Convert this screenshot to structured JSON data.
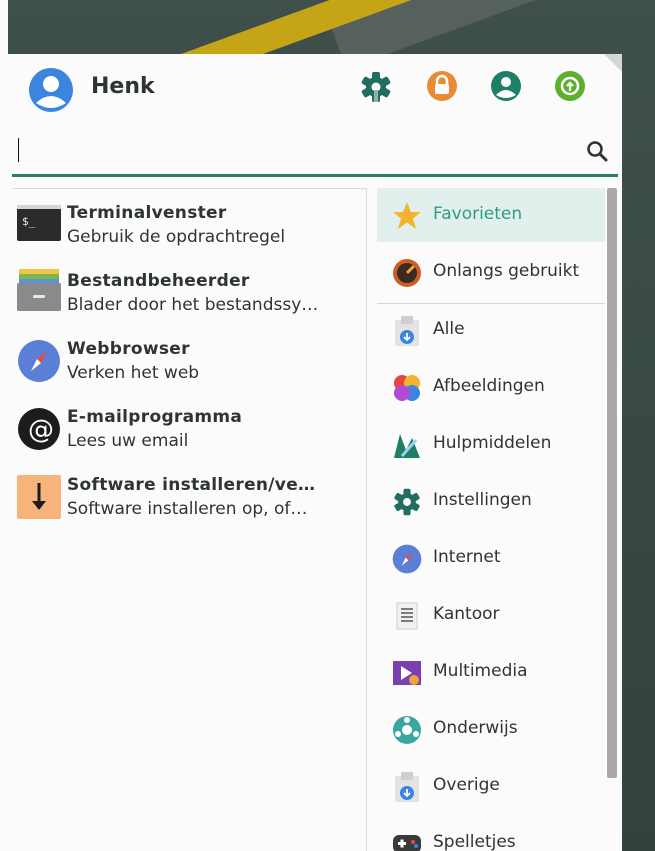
{
  "user": {
    "name": "Henk"
  },
  "header": {
    "buttons": [
      {
        "name": "settings-button",
        "icon": "gear-icon",
        "color": "#1f6e5e"
      },
      {
        "name": "lock-button",
        "icon": "lock-icon",
        "color": "#e98b36"
      },
      {
        "name": "user-button",
        "icon": "user-icon",
        "color": "#1f7e66"
      },
      {
        "name": "power-button",
        "icon": "power-icon",
        "color": "#5cb02c"
      }
    ]
  },
  "search": {
    "value": ""
  },
  "apps": [
    {
      "title": "Terminalvenster",
      "subtitle": "Gebruik de opdrachtregel",
      "icon": "terminal-icon"
    },
    {
      "title": "Bestandbeheerder",
      "subtitle": "Blader door het bestandssy…",
      "icon": "file-manager-icon"
    },
    {
      "title": "Webbrowser",
      "subtitle": "Verken het web",
      "icon": "web-browser-icon"
    },
    {
      "title": "E-mailprogramma",
      "subtitle": "Lees uw email",
      "icon": "email-icon"
    },
    {
      "title": "Software installeren/ve…",
      "subtitle": "Software installeren op, of…",
      "icon": "software-install-icon"
    }
  ],
  "categories": [
    {
      "label": "Favorieten",
      "icon": "star-icon",
      "selected": true
    },
    {
      "label": "Onlangs gebruikt",
      "icon": "recent-icon"
    },
    {
      "label": "Alle",
      "icon": "package-icon"
    },
    {
      "label": "Afbeeldingen",
      "icon": "image-icon"
    },
    {
      "label": "Hulpmiddelen",
      "icon": "tools-icon"
    },
    {
      "label": "Instellingen",
      "icon": "settings-icon"
    },
    {
      "label": "Internet",
      "icon": "internet-icon"
    },
    {
      "label": "Kantoor",
      "icon": "office-icon"
    },
    {
      "label": "Multimedia",
      "icon": "multimedia-icon"
    },
    {
      "label": "Onderwijs",
      "icon": "education-icon"
    },
    {
      "label": "Overige",
      "icon": "other-icon"
    },
    {
      "label": "Spelletjes",
      "icon": "games-icon"
    }
  ],
  "colors": {
    "accent": "#2a7d6d",
    "selected_bg": "#e2f0ed",
    "selected_text": "#2a9d85"
  }
}
